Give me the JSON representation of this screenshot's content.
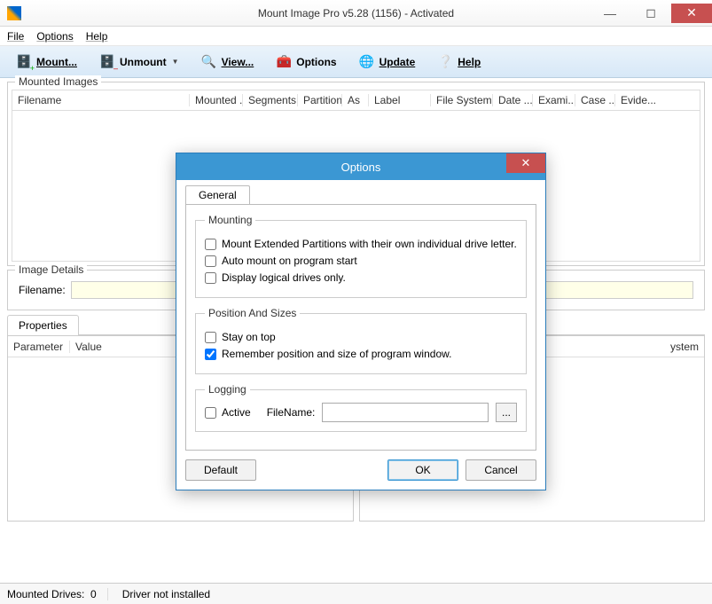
{
  "window": {
    "title": "Mount Image Pro v5.28 (1156) - Activated"
  },
  "menu": {
    "file": "File",
    "options": "Options",
    "help": "Help"
  },
  "toolbar": {
    "mount": "Mount...",
    "unmount": "Unmount",
    "view": "View...",
    "options": "Options",
    "update": "Update",
    "help": "Help"
  },
  "mounted_images": {
    "group_label": "Mounted Images",
    "columns": {
      "filename": "Filename",
      "mounted": "Mounted ...",
      "segments": "Segments",
      "partition": "Partition",
      "as": "As",
      "label": "Label",
      "filesystem": "File System",
      "date": "Date ...",
      "exami": "Exami...",
      "case": "Case ...",
      "evide": "Evide..."
    }
  },
  "image_details": {
    "group_label": "Image Details",
    "filename_label": "Filename:",
    "filename_value": ""
  },
  "properties": {
    "tab_label": "Properties",
    "columns": {
      "parameter": "Parameter",
      "value": "Value"
    },
    "right_col": "ystem"
  },
  "statusbar": {
    "mounted_drives_label": "Mounted Drives:",
    "mounted_drives_value": "0",
    "driver_status": "Driver not installed"
  },
  "dialog": {
    "title": "Options",
    "tab_general": "General",
    "mounting": {
      "legend": "Mounting",
      "opt_ext_partitions": "Mount Extended Partitions with their own individual drive letter.",
      "opt_auto_mount": "Auto mount on program start",
      "opt_logical_only": "Display logical drives only."
    },
    "position": {
      "legend": "Position And Sizes",
      "opt_stay_on_top": "Stay on top",
      "opt_remember": "Remember position and size of program window."
    },
    "logging": {
      "legend": "Logging",
      "opt_active": "Active",
      "filename_label": "FileName:",
      "filename_value": "",
      "browse": "..."
    },
    "buttons": {
      "default": "Default",
      "ok": "OK",
      "cancel": "Cancel"
    },
    "checked": {
      "remember": true,
      "ext": false,
      "auto": false,
      "logical": false,
      "stay": false,
      "active": false
    }
  }
}
